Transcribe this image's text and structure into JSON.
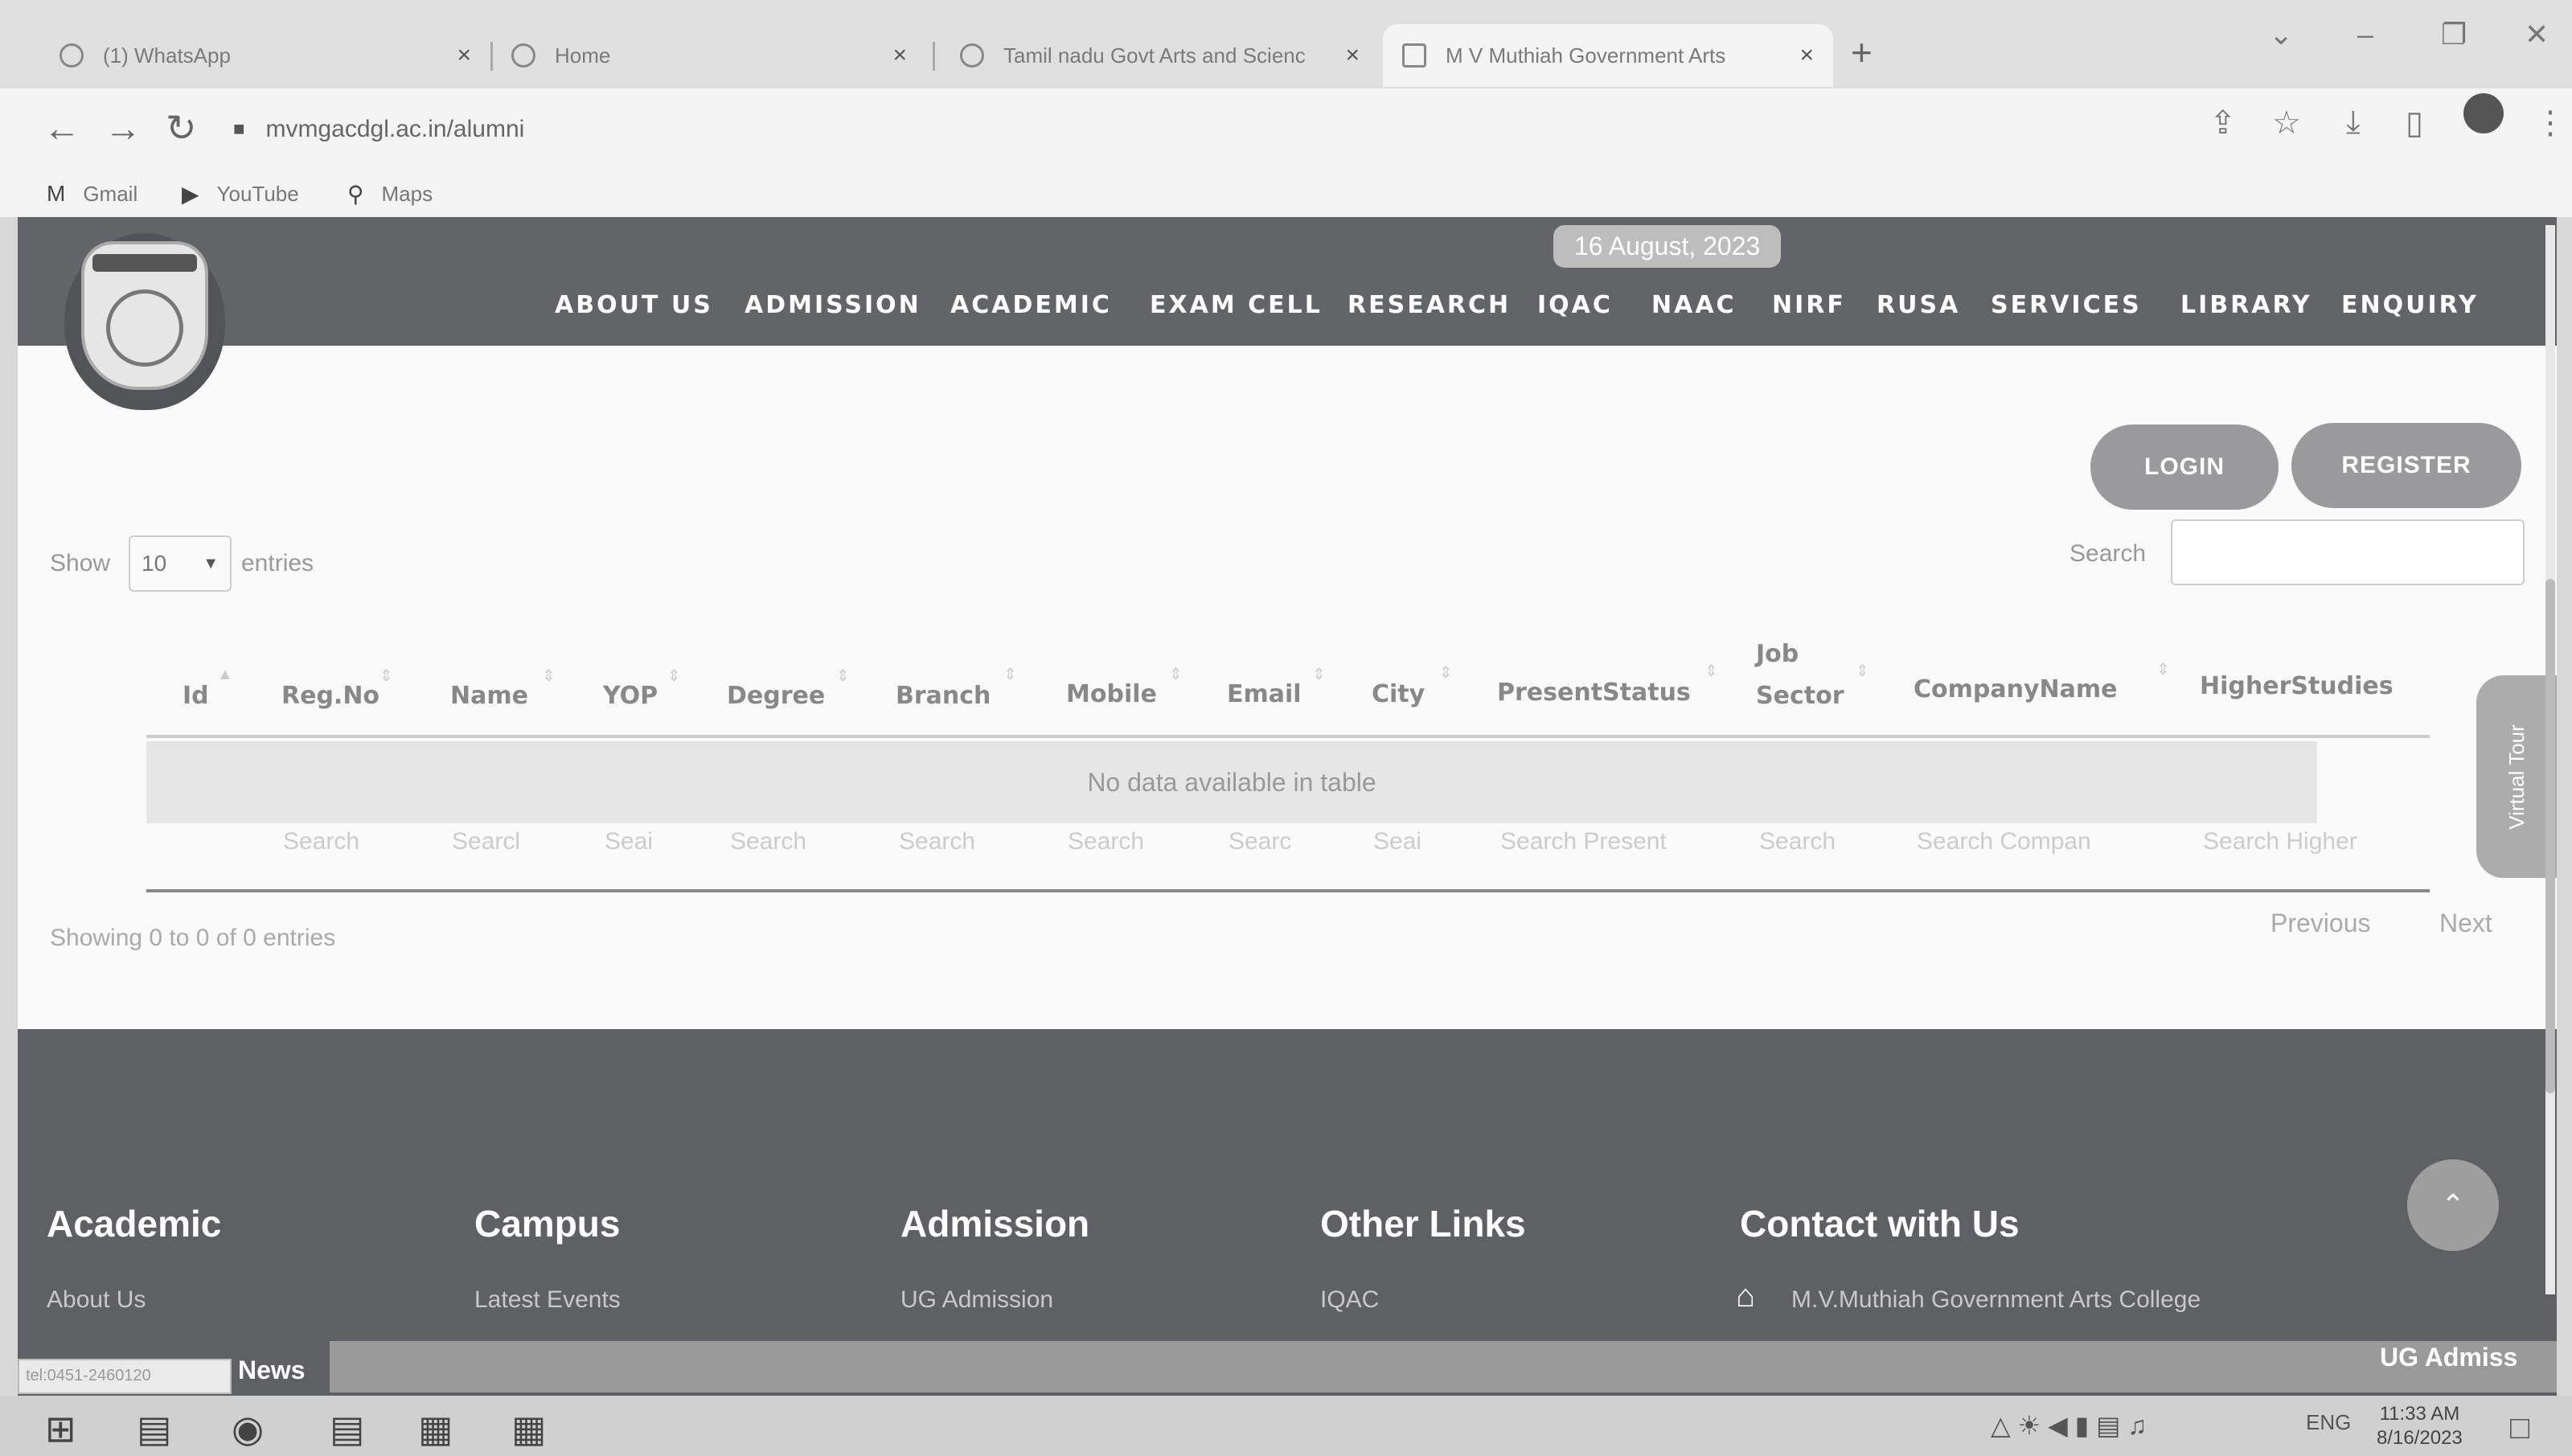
{
  "browser": {
    "tabs": [
      {
        "title": "(1) WhatsApp",
        "close": "×"
      },
      {
        "title": "Home",
        "close": "×"
      },
      {
        "title": "Tamil nadu Govt Arts and Scienc",
        "close": "×"
      },
      {
        "title": "M V Muthiah Government Arts",
        "close": "×"
      }
    ],
    "new_tab": "+",
    "window_controls": {
      "dropdown": "⌄",
      "minimize": "–",
      "restore": "❐",
      "close": "✕"
    },
    "nav": {
      "back": "←",
      "forward": "→",
      "reload": "↻"
    },
    "url": "mvmgacdgl.ac.in/alumni",
    "toolbar_icons": {
      "share": "⇪",
      "star": "☆",
      "download": "⤓",
      "sidepanel": "▯",
      "menu": "⋮"
    },
    "bookmarks": [
      {
        "icon": "M",
        "label": "Gmail"
      },
      {
        "icon": "▶",
        "label": "YouTube"
      },
      {
        "icon": "⚲",
        "label": "Maps"
      }
    ]
  },
  "header": {
    "date": "16 August, 2023",
    "menu": [
      "ABOUT US",
      "ADMISSION",
      "ACADEMIC",
      "EXAM CELL",
      "RESEARCH",
      "IQAC",
      "NAAC",
      "NIRF",
      "RUSA",
      "SERVICES",
      "LIBRARY",
      "ENQUIRY"
    ]
  },
  "auth": {
    "login": "LOGIN",
    "register": "REGISTER"
  },
  "table": {
    "show_label": "Show",
    "entries_value": "10",
    "entries_label": "entries",
    "search_label": "Search",
    "columns": [
      "Id",
      "Reg.No",
      "Name",
      "YOP",
      "Degree",
      "Branch",
      "Mobile",
      "Email",
      "City",
      "PresentStatus",
      "Job Sector",
      "CompanyName",
      "HigherStudies"
    ],
    "empty_message": "No data available in table",
    "column_search_placeholders": [
      "Search",
      "Searcl",
      "Seai",
      "Search",
      "Search",
      "Search",
      "Searc",
      "Seai",
      "Search Present",
      "Search",
      "Search Compan",
      "Search Higher"
    ],
    "info": "Showing 0 to 0 of 0 entries",
    "previous": "Previous",
    "next": "Next"
  },
  "virtual_tour": "Virtual Tour",
  "footer": {
    "sections": [
      {
        "heading": "Academic",
        "link": "About Us"
      },
      {
        "heading": "Campus",
        "link": "Latest Events"
      },
      {
        "heading": "Admission",
        "link": "UG Admission"
      },
      {
        "heading": "Other Links",
        "link": "IQAC"
      },
      {
        "heading": "Contact with Us",
        "link": "M.V.Muthiah Government Arts College"
      }
    ],
    "scroll_top": "⌃"
  },
  "news": {
    "label": "News",
    "item": "UG Admiss",
    "status_url": "tel:0451-2460120"
  },
  "taskbar": {
    "time": "11:33 AM",
    "date": "8/16/2023",
    "lang": "ENG"
  },
  "colors": {
    "header_bg": "#626468",
    "footer_bg": "#5e6064",
    "button_bg": "#9a9a9c"
  }
}
